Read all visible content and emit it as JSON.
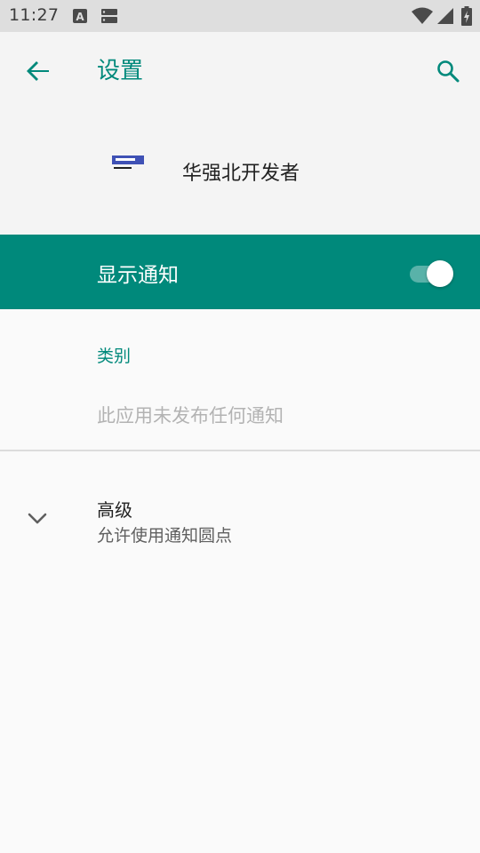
{
  "status_bar": {
    "time": "11:27",
    "icons": [
      "a-keyboard-icon",
      "storage-icon",
      "wifi-icon",
      "signal-icon",
      "battery-charging-icon"
    ]
  },
  "app_bar": {
    "title": "设置",
    "back_icon": "arrow-left-icon",
    "search_icon": "search-icon",
    "accent_color": "#00897b"
  },
  "app_header": {
    "app_name": "华强北开发者",
    "app_icon": "developer-icon"
  },
  "notifications": {
    "show_label": "显示通知",
    "enabled": true,
    "switch_color": "#00897b"
  },
  "category": {
    "header": "类别",
    "empty_text": "此应用未发布任何通知"
  },
  "advanced": {
    "title": "高级",
    "summary": "允许使用通知圆点",
    "chevron_icon": "chevron-down-icon"
  }
}
